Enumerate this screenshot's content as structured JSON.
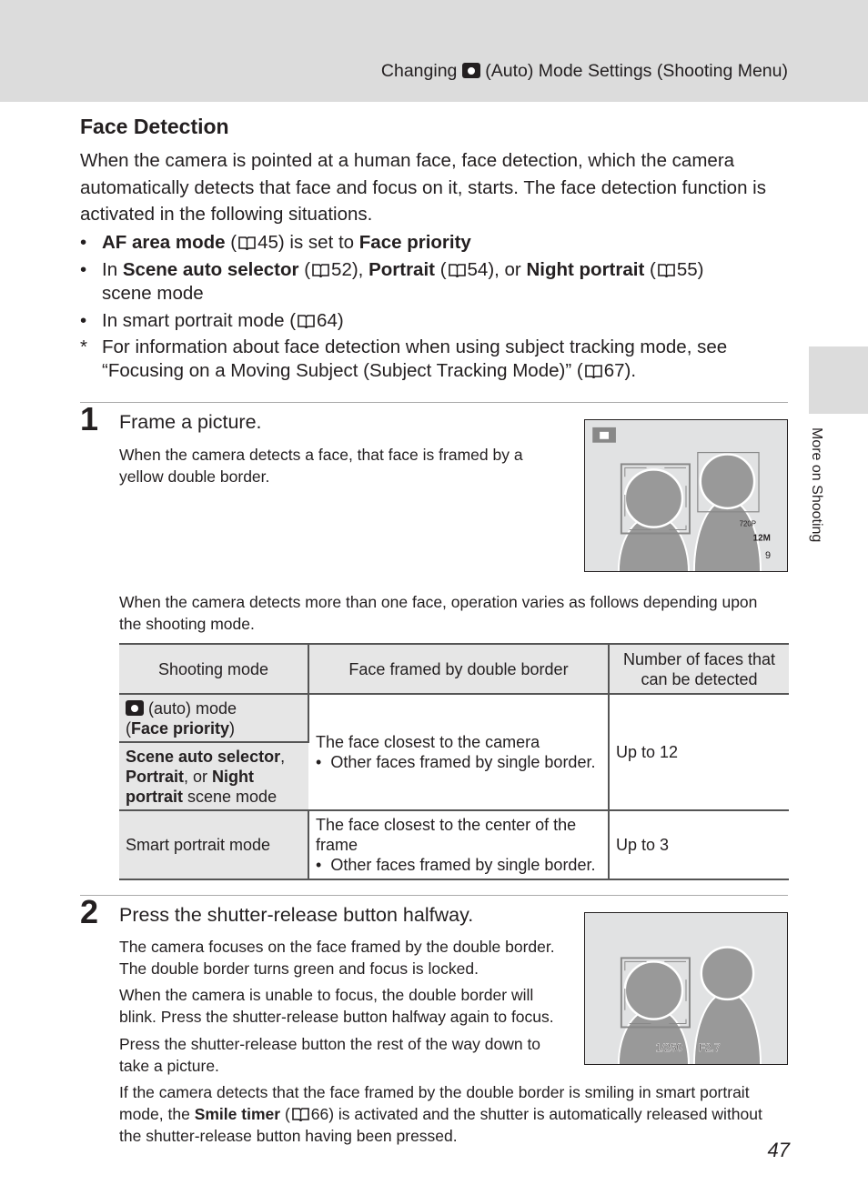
{
  "header": {
    "title_pre": "Changing",
    "title_post": "(Auto) Mode Settings (Shooting Menu)"
  },
  "side_tab": {
    "label": "More on Shooting"
  },
  "section": {
    "title": "Face Detection",
    "intro": "When the camera is pointed at a human face, face detection, which the camera automatically detects that face and focus on it, starts. The face detection function is activated in the following situations.",
    "bullets": [
      {
        "b1": "AF area mode",
        "t1": "(",
        "ref": "45) is set to",
        "b2": "Face priority"
      },
      {
        "t0": "In",
        "b1": "Scene auto selector",
        "r1": "(",
        "r1n": "52),",
        "b2": "Portrait",
        "r2": "(",
        "r2n": "54), or",
        "b3": "Night portrait",
        "r3": "(",
        "r3n": "55)",
        "t_end": "scene mode"
      },
      {
        "t0": "In smart portrait mode (",
        "r1n": "64)"
      }
    ],
    "note": {
      "mark": "*",
      "line1": "For information about face detection when using subject tracking mode, see",
      "line2": "“Focusing on a Moving Subject (Subject Tracking Mode)” (",
      "ref": "67)."
    }
  },
  "step1": {
    "num": "1",
    "title": "Frame a picture.",
    "text": "When the camera detects a face, that face is framed by a yellow double border.",
    "more": "When the camera detects more than one face, operation varies as follows depending upon the shooting mode.",
    "screen": {
      "res": "720P",
      "size": "12M",
      "count": "9"
    }
  },
  "table": {
    "headers": [
      "Shooting mode",
      "Face framed by double border",
      "Number of faces that can be detected"
    ],
    "row1": {
      "mode_a_post": "(auto) mode",
      "mode_a2_open": "(",
      "mode_a2_bold": "Face priority",
      "mode_a2_close": ")",
      "mode_b1": "Scene auto selector",
      ",": ",",
      "mode_b2": "Portrait",
      "mode_b_or": ", or",
      "mode_b3": "Night",
      "mode_b4": "portrait",
      "mode_b_end": "scene mode",
      "framed": "The face closest to the camera",
      "framed_bullet": "Other faces framed by single border.",
      "count": "Up to 12"
    },
    "row2": {
      "mode": "Smart portrait mode",
      "framed": "The face closest to the center of the frame",
      "framed_bullet": "Other faces framed by single border.",
      "count": "Up to 3"
    }
  },
  "step2": {
    "num": "2",
    "title": "Press the shutter-release button halfway.",
    "p1": "The camera focuses on the face framed by the double border. The double border turns green and focus is locked.",
    "p2": "When the camera is unable to focus, the double border will blink. Press the shutter-release button halfway again to focus.",
    "p3": "Press the shutter-release button the rest of the way down to take a picture.",
    "p4a": "If the camera detects that the face framed by the double border is smiling in smart portrait mode, the",
    "p4b": "Smile timer",
    "p4c": "(",
    "p4d": "66) is activated and the shutter is automatically released without the shutter-release button having been pressed.",
    "screen": {
      "shutter": "1/250",
      "aperture": "F2.7"
    }
  },
  "page_number": "47"
}
